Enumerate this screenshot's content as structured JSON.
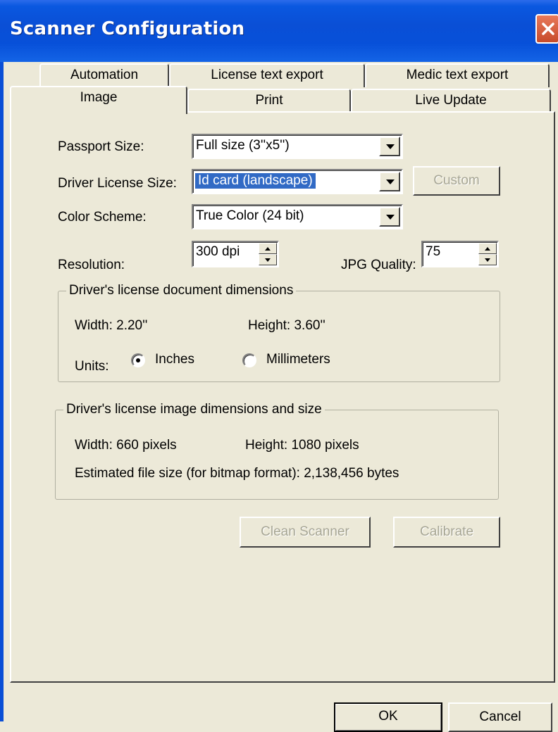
{
  "window": {
    "title": "Scanner Configuration"
  },
  "tabs_back": [
    "Automation",
    "License text export",
    "Medic text export"
  ],
  "tabs_front": [
    "Image",
    "Print",
    "Live Update"
  ],
  "form": {
    "passport_label": "Passport Size:",
    "passport_value": "Full size (3''x5'')",
    "driver_label": "Driver License Size:",
    "driver_value": "Id card (landscape)",
    "custom_button": "Custom",
    "color_label": "Color Scheme:",
    "color_value": "True Color (24 bit)",
    "resolution_label": "Resolution:",
    "resolution_value": "300 dpi",
    "jpg_label": "JPG Quality:",
    "jpg_value": "75"
  },
  "doc_dims": {
    "title": "Driver's license document dimensions",
    "width_text": "Width:  2.20''",
    "height_text": "Height: 3.60''",
    "units_label": "Units:",
    "units_options": [
      "Inches",
      "Millimeters"
    ],
    "selected_unit": "Inches"
  },
  "image_dims": {
    "title": "Driver's license image dimensions and size",
    "width_text": "Width:   660 pixels",
    "height_text": "Height:  1080 pixels",
    "filesize_text": "Estimated file size (for bitmap format):   2,138,456 bytes"
  },
  "actions": {
    "clean": "Clean Scanner",
    "calibrate": "Calibrate"
  },
  "footer": {
    "ok": "OK",
    "cancel": "Cancel"
  },
  "colors": {
    "titlebar": "#0A4FD6",
    "selection": "#316AC5",
    "face": "#ECE9D8",
    "close": "#D85A3A"
  }
}
